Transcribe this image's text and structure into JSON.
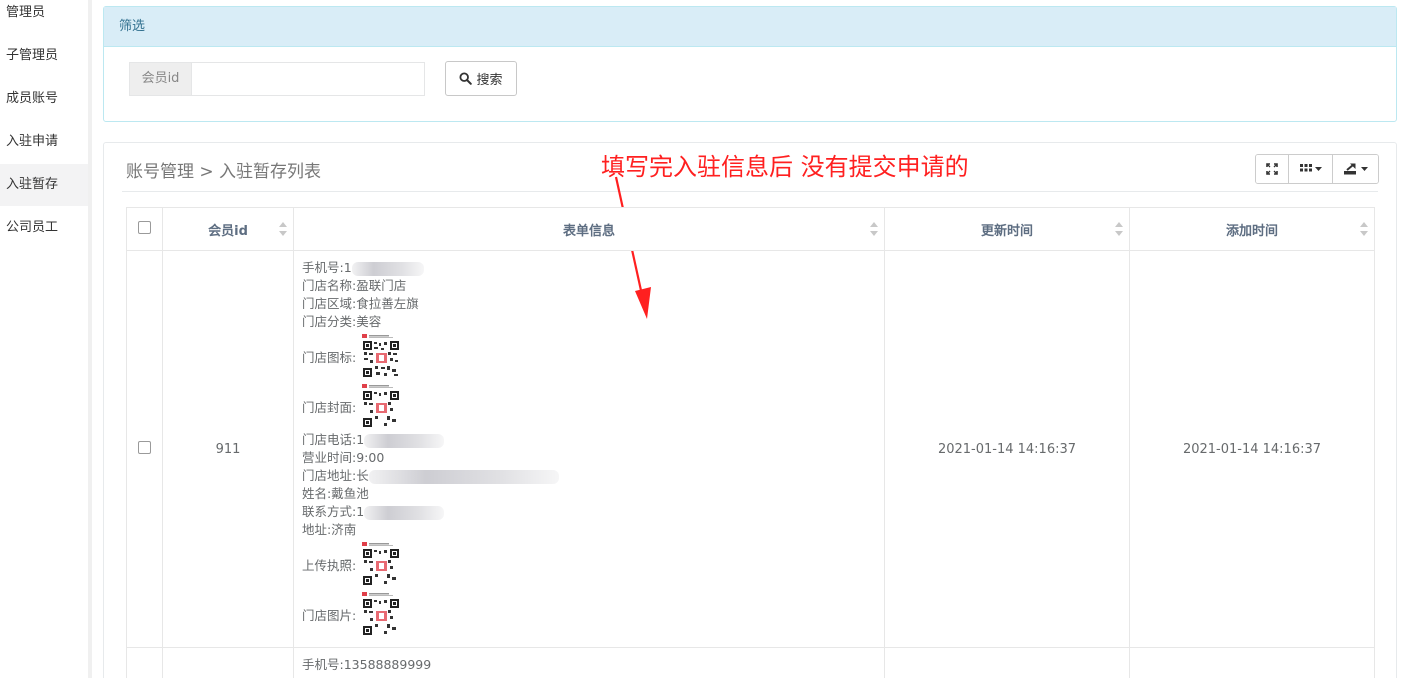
{
  "sidebar": {
    "items": [
      {
        "label": "管理员",
        "active": false
      },
      {
        "label": "子管理员",
        "active": false
      },
      {
        "label": "成员账号",
        "active": false
      },
      {
        "label": "入驻申请",
        "active": false
      },
      {
        "label": "入驻暂存",
        "active": true
      },
      {
        "label": "公司员工",
        "active": false
      }
    ]
  },
  "filter": {
    "heading": "筛选",
    "member_id_label": "会员id",
    "member_id_value": "",
    "search_label": "搜索"
  },
  "list": {
    "breadcrumb": "账号管理 > 入驻暂存列表",
    "annotation": "填写完入驻信息后 没有提交申请的",
    "toolbar_icons": [
      "fullscreen-icon",
      "columns-icon",
      "export-icon"
    ]
  },
  "table": {
    "headers": {
      "member_id": "会员id",
      "form_info": "表单信息",
      "updated_at": "更新时间",
      "created_at": "添加时间"
    },
    "rows": [
      {
        "member_id": "911",
        "form": {
          "phone_label": "手机号:",
          "phone_value": "1",
          "store_name": "门店名称:盈联门店",
          "store_region": "门店区域:食拉善左旗",
          "store_category": "门店分类:美容",
          "store_logo_label": "门店图标:",
          "store_cover_label": "门店封面:",
          "store_tel_label": "门店电话:",
          "store_tel_value": "1",
          "business_hours": "营业时间:9:00",
          "store_address_label": "门店地址:",
          "store_address_value": "长",
          "name": "姓名:戴鱼池",
          "contact_label": "联系方式:",
          "contact_value": "1",
          "address": "地址:济南",
          "license_label": "上传执照:",
          "store_photo_label": "门店图片:"
        },
        "updated_at": "2021-01-14 14:16:37",
        "created_at": "2021-01-14 14:16:37"
      },
      {
        "member_id": "",
        "form": {
          "phone": "手机号:13588889999"
        },
        "updated_at": "",
        "created_at": ""
      }
    ]
  },
  "colors": {
    "panel_heading_bg": "#d9edf7",
    "panel_border": "#bce8f1",
    "annotation": "#ff2020",
    "active_nav_bg": "#f3f3f4"
  }
}
